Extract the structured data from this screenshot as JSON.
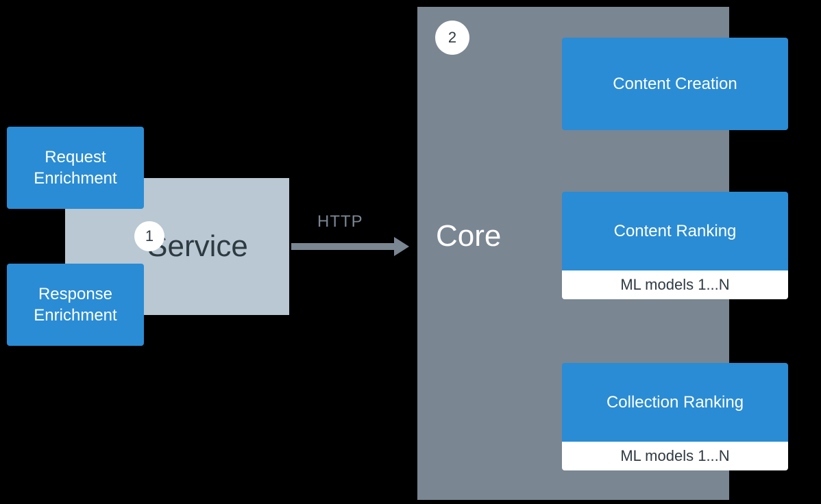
{
  "service": {
    "label": "Service",
    "badge": "1",
    "request_label": "Request\nEnrichment",
    "response_label": "Response\nEnrichment"
  },
  "connection": {
    "label": "HTTP"
  },
  "core": {
    "label": "Core",
    "badge": "2",
    "content_creation": "Content Creation",
    "content_ranking": "Content Ranking",
    "content_ranking_sub": "ML models 1...N",
    "collection_ranking": "Collection Ranking",
    "collection_ranking_sub": "ML models 1...N"
  }
}
